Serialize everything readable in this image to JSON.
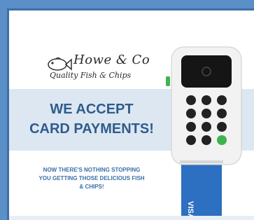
{
  "logo": {
    "name": "Howe & Co",
    "tagline": "Quality Fish & Chips"
  },
  "headline": {
    "line1": "WE ACCEPT",
    "line2": "CARD PAYMENTS!"
  },
  "subline": {
    "line1": "NOW THERE'S NOTHING STOPPING",
    "line2": "YOU GETTING THOSE DELICIOUS FISH",
    "line3": "& CHIPS!"
  },
  "card": {
    "brand": "VISA"
  },
  "colors": {
    "frame": "#5b8fc7",
    "headline": "#2f5c8c",
    "band": "#dce7f2",
    "card": "#2d6fc0",
    "reader_body": "#f2f2f2",
    "keypad": "#222222",
    "ok_key": "#3fb34f"
  }
}
